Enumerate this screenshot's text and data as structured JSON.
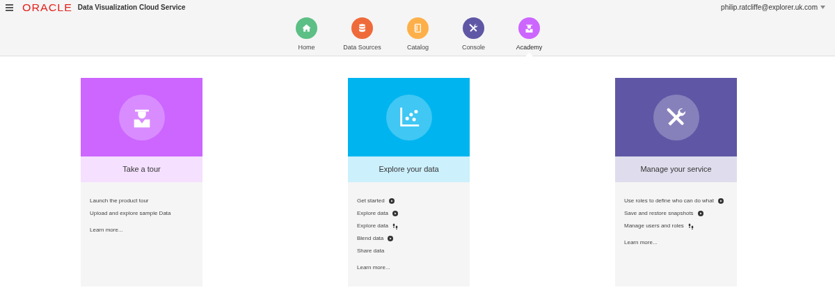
{
  "header": {
    "brand": "ORACLE",
    "product": "Data Visualization Cloud Service",
    "user": "philip.ratcliffe@explorer.uk.com"
  },
  "nav": [
    {
      "label": "Home",
      "color": "#5cbf85",
      "selected": false
    },
    {
      "label": "Data Sources",
      "color": "#ef6a3a",
      "selected": false
    },
    {
      "label": "Catalog",
      "color": "#fdb04a",
      "selected": false
    },
    {
      "label": "Console",
      "color": "#5f57a5",
      "selected": false
    },
    {
      "label": "Academy",
      "color": "#cc66ff",
      "selected": true
    }
  ],
  "cards": [
    {
      "title": "Take a tour",
      "color": "#cc66ff",
      "links": [
        {
          "text": "Launch the product tour",
          "kind": "plain"
        },
        {
          "text": "Upload and explore sample Data",
          "kind": "plain"
        }
      ],
      "more": "Learn more..."
    },
    {
      "title": "Explore your data",
      "color": "#00b5ef",
      "links": [
        {
          "text": "Get started",
          "kind": "video"
        },
        {
          "text": "Explore data",
          "kind": "video"
        },
        {
          "text": "Explore data",
          "kind": "steps"
        },
        {
          "text": "Blend data",
          "kind": "video"
        },
        {
          "text": "Share data",
          "kind": "plain"
        }
      ],
      "more": "Learn more..."
    },
    {
      "title": "Manage your service",
      "color": "#5f57a5",
      "links": [
        {
          "text": "Use roles to define who can do what",
          "kind": "video"
        },
        {
          "text": "Save and restore snapshots",
          "kind": "video"
        },
        {
          "text": "Manage users and roles",
          "kind": "steps"
        }
      ],
      "more": "Learn more..."
    }
  ]
}
